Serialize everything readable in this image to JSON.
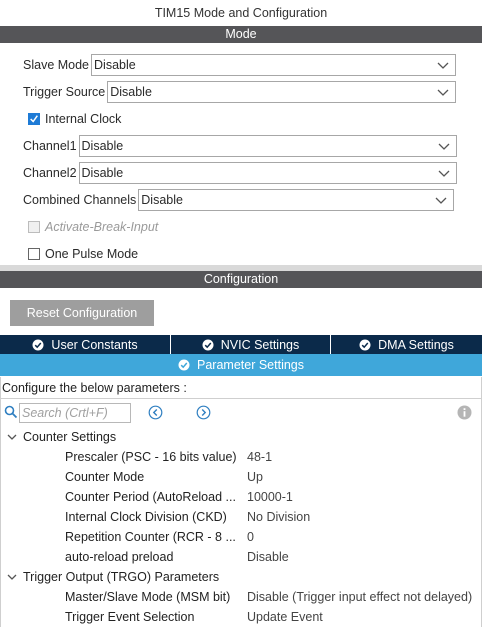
{
  "window": {
    "title": "TIM15 Mode and Configuration"
  },
  "mode": {
    "header": "Mode",
    "slave_mode": {
      "label": "Slave Mode",
      "value": "Disable"
    },
    "trigger_source": {
      "label": "Trigger Source",
      "value": "Disable"
    },
    "internal_clock": {
      "label": "Internal Clock",
      "checked": true
    },
    "channel1": {
      "label": "Channel1",
      "value": "Disable"
    },
    "channel2": {
      "label": "Channel2",
      "value": "Disable"
    },
    "combined_channels": {
      "label": "Combined Channels",
      "value": "Disable"
    },
    "activate_break_input": {
      "label": "Activate-Break-Input",
      "checked": false,
      "enabled": false
    },
    "one_pulse_mode": {
      "label": "One Pulse Mode",
      "checked": false
    }
  },
  "configuration": {
    "header": "Configuration",
    "reset_button": "Reset Configuration",
    "tabs": [
      {
        "label": "User Constants",
        "icon": "check-circle-icon"
      },
      {
        "label": "NVIC Settings",
        "icon": "check-circle-icon"
      },
      {
        "label": "DMA Settings",
        "icon": "check-circle-icon"
      }
    ],
    "active_tab": {
      "label": "Parameter Settings",
      "icon": "check-circle-icon"
    },
    "instructions": "Configure the below parameters :",
    "search": {
      "placeholder": "Search (Crtl+F)"
    },
    "groups": [
      {
        "name": "Counter Settings",
        "params": [
          {
            "name": "Prescaler (PSC - 16 bits value)",
            "value": "48-1"
          },
          {
            "name": "Counter Mode",
            "value": "Up"
          },
          {
            "name": "Counter Period (AutoReload ...",
            "value": "10000-1"
          },
          {
            "name": "Internal Clock Division (CKD)",
            "value": "No Division"
          },
          {
            "name": "Repetition Counter (RCR - 8 ...",
            "value": "0"
          },
          {
            "name": "auto-reload preload",
            "value": "Disable"
          }
        ]
      },
      {
        "name": "Trigger Output (TRGO) Parameters",
        "params": [
          {
            "name": "Master/Slave Mode (MSM bit)",
            "value": "Disable (Trigger input effect not delayed)"
          },
          {
            "name": "Trigger Event Selection",
            "value": "Update Event"
          }
        ]
      }
    ]
  },
  "colors": {
    "section_bar": "#555558",
    "tab_bar": "#0b2a4a",
    "active_tab": "#3fa7da",
    "checkbox_checked": "#1e7bd6",
    "reset_button": "#9e9e9e"
  }
}
